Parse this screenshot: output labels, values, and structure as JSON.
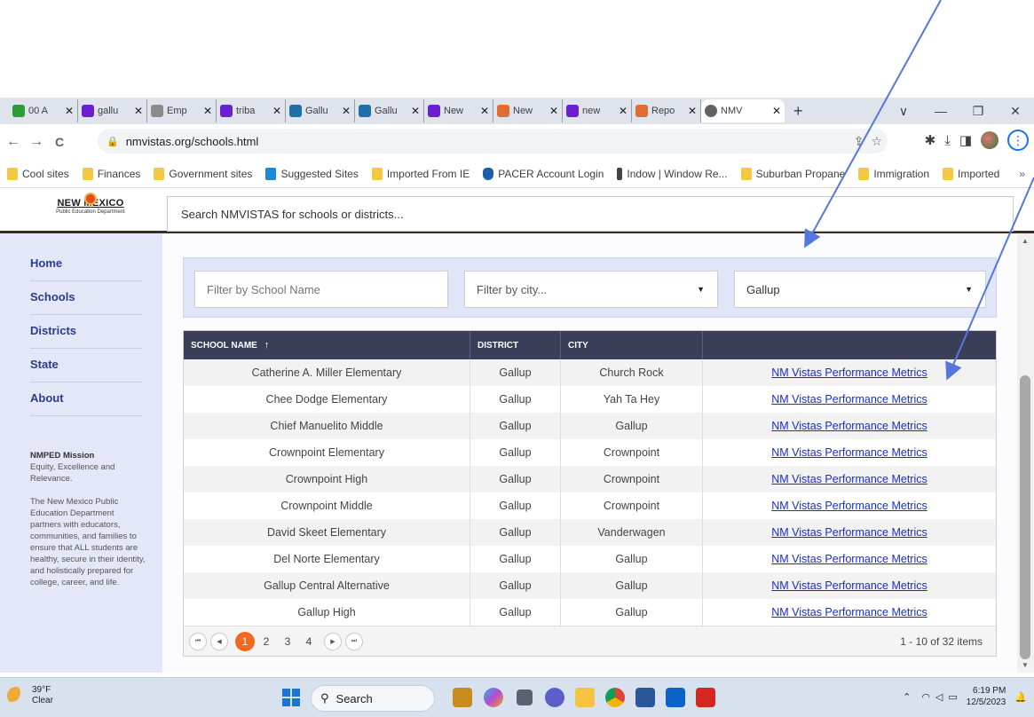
{
  "browser": {
    "tabs": [
      {
        "label": "00 A",
        "color": "#2a9d3a"
      },
      {
        "label": "gallu",
        "color": "#6a1fd1"
      },
      {
        "label": "Emp",
        "color": "#8a8a8a"
      },
      {
        "label": "triba",
        "color": "#6a1fd1"
      },
      {
        "label": "Gallu",
        "color": "#1e6fa8"
      },
      {
        "label": "Gallu",
        "color": "#1e6fa8"
      },
      {
        "label": "New",
        "color": "#6a1fd1"
      },
      {
        "label": "New",
        "color": "#e26b2f"
      },
      {
        "label": "new",
        "color": "#6a1fd1"
      },
      {
        "label": "Repo",
        "color": "#e26b2f"
      }
    ],
    "active_tab": {
      "label": "NMV"
    },
    "tab_close": "✕",
    "new_tab": "+",
    "window_controls": {
      "chevron": "∨",
      "minimize": "—",
      "restore": "❐",
      "close": "✕"
    },
    "nav": {
      "back": "←",
      "forward": "→",
      "reload": "C"
    },
    "url": "nmvistas.org/schools.html",
    "bookmarks": [
      {
        "label": "Cool sites",
        "icon": "folder"
      },
      {
        "label": "Finances",
        "icon": "folder"
      },
      {
        "label": "Government sites",
        "icon": "folder"
      },
      {
        "label": "Suggested Sites",
        "icon": "bing"
      },
      {
        "label": "Imported From IE",
        "icon": "folder"
      },
      {
        "label": "PACER Account Login",
        "icon": "shield"
      },
      {
        "label": "Indow | Window Re...",
        "icon": "dark"
      },
      {
        "label": "Suburban Propane",
        "icon": "folder"
      },
      {
        "label": "Immigration",
        "icon": "folder"
      },
      {
        "label": "Imported",
        "icon": "folder"
      }
    ],
    "bookmarks_more": "»"
  },
  "site": {
    "logo_title": "NEW MEXICO",
    "logo_subtitle": "Public Education Department",
    "search_placeholder": "Search NMVISTAS for schools or districts...",
    "nav": [
      "Home",
      "Schools",
      "Districts",
      "State",
      "About"
    ],
    "mission_title": "NMPED Mission",
    "mission_line": "Equity, Excellence and Relevance.",
    "mission_body": "The New Mexico Public Education Department partners with educators, communities, and families to ensure that ALL students are healthy, secure in their identity, and holistically prepared for college, career, and life."
  },
  "filters": {
    "school_placeholder": "Filter by School Name",
    "city_placeholder": "Filter by city...",
    "district_value": "Gallup"
  },
  "grid": {
    "headers": [
      "SCHOOL NAME",
      "DISTRICT",
      "CITY",
      ""
    ],
    "sort_icon": "↑",
    "rows": [
      {
        "school": "Catherine A. Miller Elementary",
        "district": "Gallup",
        "city": "Church Rock",
        "link": "NM Vistas Performance Metrics"
      },
      {
        "school": "Chee Dodge Elementary",
        "district": "Gallup",
        "city": "Yah Ta Hey",
        "link": "NM Vistas Performance Metrics"
      },
      {
        "school": "Chief Manuelito Middle",
        "district": "Gallup",
        "city": "Gallup",
        "link": "NM Vistas Performance Metrics"
      },
      {
        "school": "Crownpoint Elementary",
        "district": "Gallup",
        "city": "Crownpoint",
        "link": "NM Vistas Performance Metrics"
      },
      {
        "school": "Crownpoint High",
        "district": "Gallup",
        "city": "Crownpoint",
        "link": "NM Vistas Performance Metrics"
      },
      {
        "school": "Crownpoint Middle",
        "district": "Gallup",
        "city": "Crownpoint",
        "link": "NM Vistas Performance Metrics"
      },
      {
        "school": "David Skeet Elementary",
        "district": "Gallup",
        "city": "Vanderwagen",
        "link": "NM Vistas Performance Metrics"
      },
      {
        "school": "Del Norte Elementary",
        "district": "Gallup",
        "city": "Gallup",
        "link": "NM Vistas Performance Metrics"
      },
      {
        "school": "Gallup Central Alternative",
        "district": "Gallup",
        "city": "Gallup",
        "link": "NM Vistas Performance Metrics"
      },
      {
        "school": "Gallup High",
        "district": "Gallup",
        "city": "Gallup",
        "link": "NM Vistas Performance Metrics"
      }
    ],
    "pager": {
      "first": "⏮",
      "prev": "◀",
      "next": "▶",
      "last": "⏭",
      "pages": [
        "1",
        "2",
        "3",
        "4"
      ],
      "current": "1",
      "info": "1 - 10 of 32 items"
    }
  },
  "taskbar": {
    "temp": "39°F",
    "condition": "Clear",
    "search_label": "Search",
    "time": "6:19 PM",
    "date": "12/5/2023"
  },
  "colors": {
    "accent_orange": "#f26a21",
    "grid_header": "#3b3e58",
    "nav_text": "#2e3a8c",
    "link": "#1a2bd9",
    "arrow": "#5577dd"
  }
}
